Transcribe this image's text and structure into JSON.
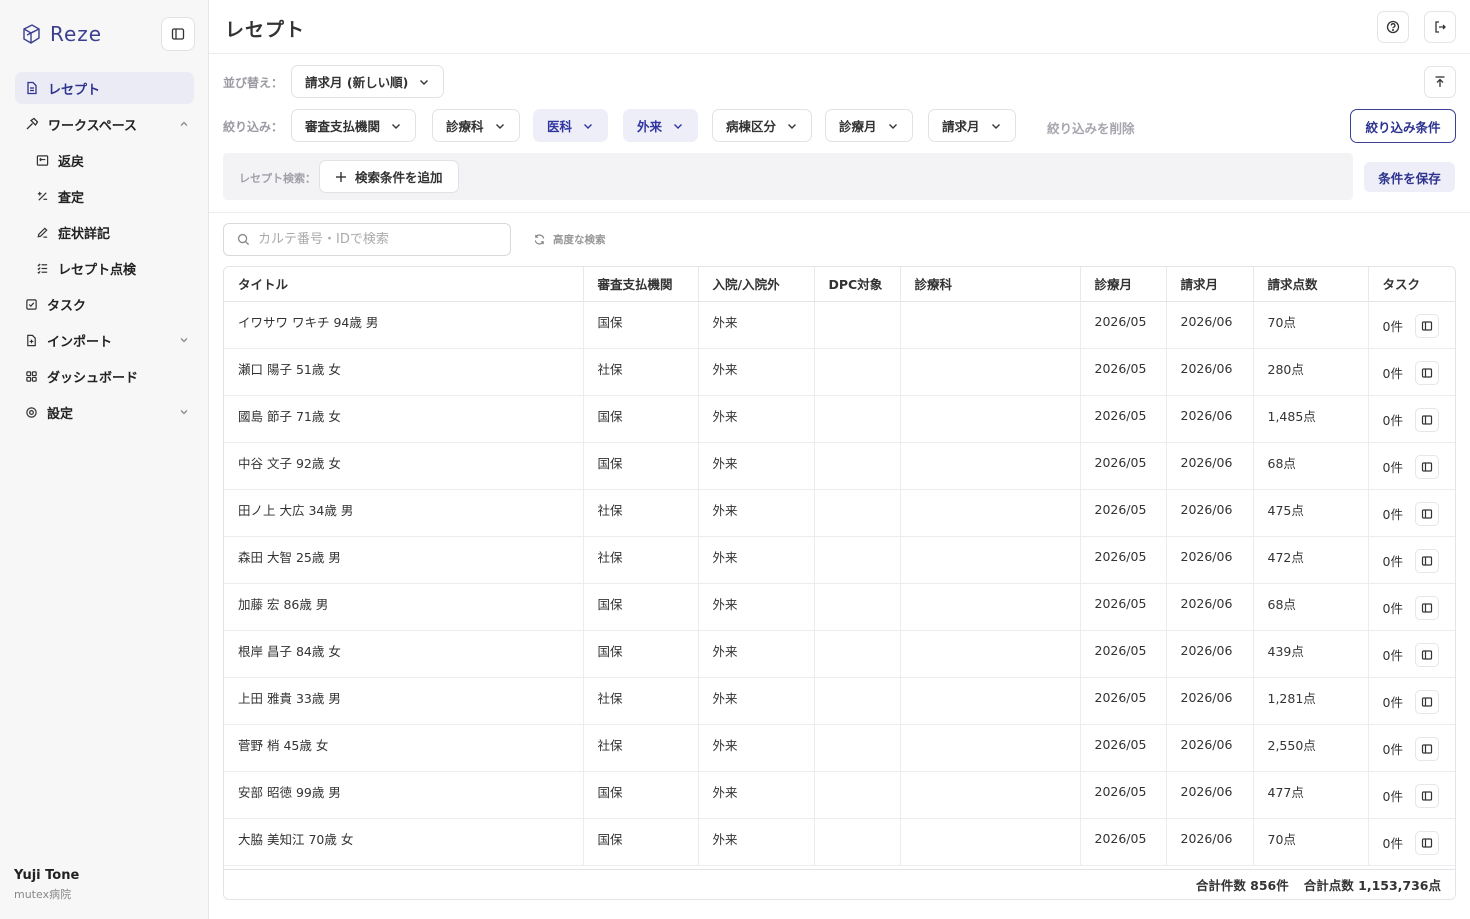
{
  "brand": {
    "name": "Reze"
  },
  "sidebar": {
    "items": [
      {
        "label": "レセプト"
      },
      {
        "label": "ワークスペース"
      },
      {
        "label": "返戻"
      },
      {
        "label": "査定"
      },
      {
        "label": "症状詳記"
      },
      {
        "label": "レセプト点検"
      },
      {
        "label": "タスク"
      },
      {
        "label": "インポート"
      },
      {
        "label": "ダッシュボード"
      },
      {
        "label": "設定"
      }
    ],
    "user": {
      "name": "Yuji Tone",
      "org": "mutex病院"
    }
  },
  "header": {
    "title": "レセプト"
  },
  "sort": {
    "label": "並び替え：",
    "value": "請求月 (新しい順)"
  },
  "filters": {
    "label": "絞り込み：",
    "items": [
      "審査支払機関",
      "診療科",
      "医科",
      "外来",
      "病棟区分",
      "診療月",
      "請求月"
    ],
    "clear_label": "絞り込みを削除",
    "conditions_button": "絞り込み条件"
  },
  "receipt_search": {
    "label": "レセプト検索：",
    "add_label": "検索条件を追加",
    "save_label": "条件を保存"
  },
  "search": {
    "placeholder": "カルテ番号・IDで検索",
    "advanced_label": "高度な検索"
  },
  "table": {
    "columns": [
      "タイトル",
      "審査支払機関",
      "入院/入院外",
      "DPC対象",
      "診療科",
      "診療月",
      "請求月",
      "請求点数",
      "タスク"
    ],
    "rows": [
      {
        "title": "イワサワ ワキチ  94歳  男",
        "payer": "国保",
        "inpatient": "外来",
        "dpc": "",
        "dept": "",
        "service_month": "2026/05",
        "billing_month": "2026/06",
        "points": "70点",
        "tasks": "0件"
      },
      {
        "title": "瀬口 陽子  51歳  女",
        "payer": "社保",
        "inpatient": "外来",
        "dpc": "",
        "dept": "",
        "service_month": "2026/05",
        "billing_month": "2026/06",
        "points": "280点",
        "tasks": "0件"
      },
      {
        "title": "國島 節子  71歳  女",
        "payer": "国保",
        "inpatient": "外来",
        "dpc": "",
        "dept": "",
        "service_month": "2026/05",
        "billing_month": "2026/06",
        "points": "1,485点",
        "tasks": "0件"
      },
      {
        "title": "中谷 文子  92歳  女",
        "payer": "国保",
        "inpatient": "外来",
        "dpc": "",
        "dept": "",
        "service_month": "2026/05",
        "billing_month": "2026/06",
        "points": "68点",
        "tasks": "0件"
      },
      {
        "title": "田ノ上 大広  34歳  男",
        "payer": "社保",
        "inpatient": "外来",
        "dpc": "",
        "dept": "",
        "service_month": "2026/05",
        "billing_month": "2026/06",
        "points": "475点",
        "tasks": "0件"
      },
      {
        "title": "森田 大智  25歳  男",
        "payer": "社保",
        "inpatient": "外来",
        "dpc": "",
        "dept": "",
        "service_month": "2026/05",
        "billing_month": "2026/06",
        "points": "472点",
        "tasks": "0件"
      },
      {
        "title": "加藤 宏  86歳  男",
        "payer": "国保",
        "inpatient": "外来",
        "dpc": "",
        "dept": "",
        "service_month": "2026/05",
        "billing_month": "2026/06",
        "points": "68点",
        "tasks": "0件"
      },
      {
        "title": "根岸 昌子  84歳  女",
        "payer": "国保",
        "inpatient": "外来",
        "dpc": "",
        "dept": "",
        "service_month": "2026/05",
        "billing_month": "2026/06",
        "points": "439点",
        "tasks": "0件"
      },
      {
        "title": "上田 雅貴  33歳  男",
        "payer": "社保",
        "inpatient": "外来",
        "dpc": "",
        "dept": "",
        "service_month": "2026/05",
        "billing_month": "2026/06",
        "points": "1,281点",
        "tasks": "0件"
      },
      {
        "title": "菅野 梢  45歳  女",
        "payer": "社保",
        "inpatient": "外来",
        "dpc": "",
        "dept": "",
        "service_month": "2026/05",
        "billing_month": "2026/06",
        "points": "2,550点",
        "tasks": "0件"
      },
      {
        "title": "安部 昭徳  99歳  男",
        "payer": "国保",
        "inpatient": "外来",
        "dpc": "",
        "dept": "",
        "service_month": "2026/05",
        "billing_month": "2026/06",
        "points": "477点",
        "tasks": "0件"
      },
      {
        "title": "大脇 美知江  70歳  女",
        "payer": "国保",
        "inpatient": "外来",
        "dpc": "",
        "dept": "",
        "service_month": "2026/05",
        "billing_month": "2026/06",
        "points": "70点",
        "tasks": "0件"
      }
    ]
  },
  "totals": {
    "count": "合計件数 856件",
    "points": "合計点数 1,153,736点"
  },
  "colors": {
    "accent": "#2d338f",
    "highlight_bg": "#eeeef8",
    "sidebar_bg": "#f7f7f8"
  }
}
